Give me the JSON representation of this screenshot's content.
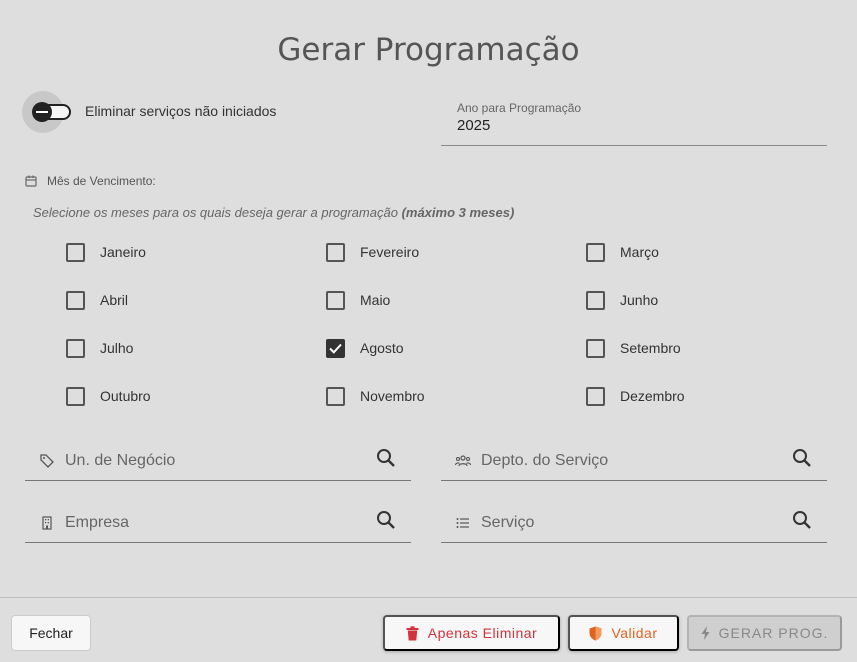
{
  "dialog": {
    "title": "Gerar Programação",
    "toggle": {
      "label": "Eliminar serviços não iniciados",
      "on": false
    },
    "year_field": {
      "label": "Ano para Programação",
      "value": "2025"
    },
    "month_section": {
      "header": "Mês de Vencimento:",
      "hint": "Selecione os meses para os quais deseja gerar a programação",
      "hint_bold": "(máximo 3 meses)",
      "months": [
        {
          "label": "Janeiro",
          "checked": false
        },
        {
          "label": "Fevereiro",
          "checked": false
        },
        {
          "label": "Março",
          "checked": false
        },
        {
          "label": "Abril",
          "checked": false
        },
        {
          "label": "Maio",
          "checked": false
        },
        {
          "label": "Junho",
          "checked": false
        },
        {
          "label": "Julho",
          "checked": false
        },
        {
          "label": "Agosto",
          "checked": true
        },
        {
          "label": "Setembro",
          "checked": false
        },
        {
          "label": "Outubro",
          "checked": false
        },
        {
          "label": "Novembro",
          "checked": false
        },
        {
          "label": "Dezembro",
          "checked": false
        }
      ]
    },
    "filters": {
      "business_unit": {
        "placeholder": "Un. de Negócio",
        "icon": "tag-icon"
      },
      "service_dept": {
        "placeholder": "Depto. do Serviço",
        "icon": "people-icon"
      },
      "company": {
        "placeholder": "Empresa",
        "icon": "building-icon"
      },
      "service": {
        "placeholder": "Serviço",
        "icon": "list-icon"
      }
    },
    "footer": {
      "close_label": "Fechar",
      "delete_only_label": "Apenas Eliminar",
      "validate_label": "Validar",
      "generate_label": "GERAR PROG."
    },
    "colors": {
      "delete": "#d2323c",
      "validate": "#e0641e",
      "disabled": "#888888"
    }
  }
}
